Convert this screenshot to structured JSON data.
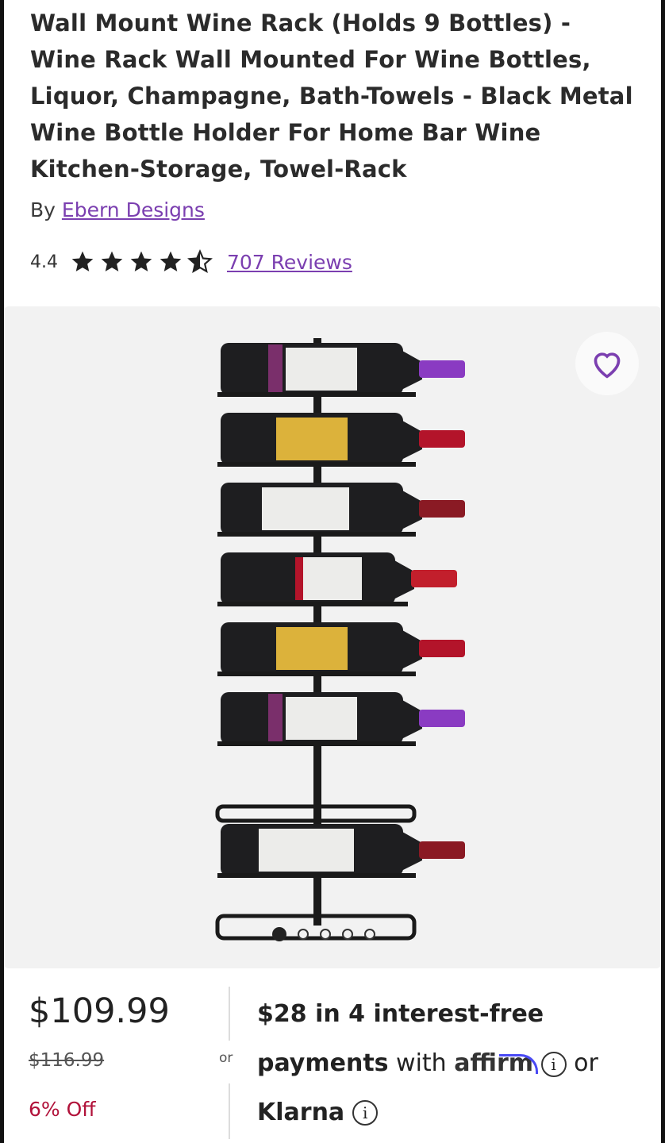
{
  "product": {
    "title": "Wall Mount Wine Rack (Holds 9 Bottles) - Wine Rack Wall Mounted For Wine Bottles, Liquor, Champagne, Bath-Towels - Black Metal Wine Bottle Holder For Home Bar Wine Kitchen-Storage, Towel-Rack",
    "by_label": "By",
    "brand": "Ebern Designs",
    "rating": "4.4",
    "rating_value": 4.4,
    "stars_max": 5,
    "reviews_link": "707 Reviews"
  },
  "gallery": {
    "favorite_icon": "heart-outline-icon",
    "image_count": 5,
    "active_index": 0
  },
  "pricing": {
    "price": "$109.99",
    "original_price": "$116.99",
    "discount": "6% Off",
    "or_label": "or",
    "installment_amount": "$28",
    "installment_text": " in 4 interest-free",
    "payments_word": "payments",
    "with_text": " with ",
    "affirm_label": "affirm",
    "or_label_2": "or",
    "klarna_label": "Klarna",
    "info_icon": "info-circle-icon"
  },
  "colors": {
    "accent_purple": "#7b3fb0",
    "discount_red": "#b1123a",
    "affirm_blue": "#4a4af4"
  }
}
